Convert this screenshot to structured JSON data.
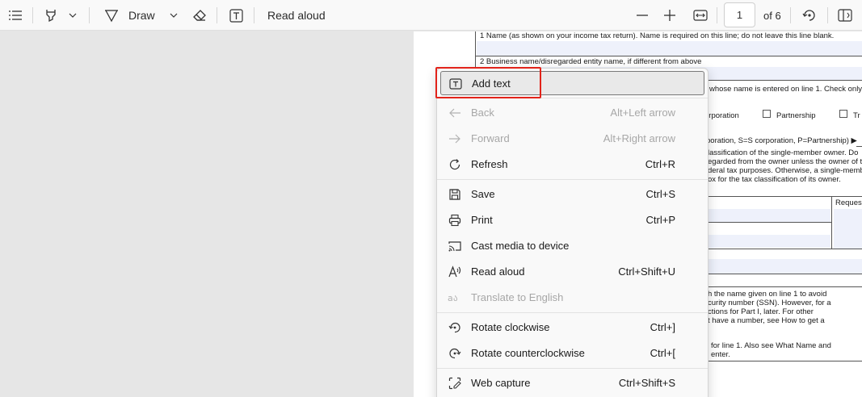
{
  "toolbar": {
    "draw_label": "Draw",
    "read_aloud_label": "Read aloud",
    "page_number": "1",
    "page_total": "of 6"
  },
  "document": {
    "line1_label": "1  Name (as shown on your income tax return). Name is required on this line; do not leave this line blank.",
    "line2_label": "2  Business name/disregarded entity name, if different from above",
    "line3_fragment": "whose name is entered on line 1. Check only o",
    "corporation_fragment": "orporation",
    "partnership_label": "Partnership",
    "trust_fragment": "Tr",
    "llc_fragment": "poration, S=S corporation, P=Partnership) ▶",
    "llc_note_lines": [
      "lassification of the single-member owner.  Do",
      "egarded from the owner unless the owner of t",
      "deral tax purposes. Otherwise, a single-memb",
      "ox for the tax classification of its owner."
    ],
    "requester_fragment": "Reques",
    "part1_lines": [
      "h the name given on line 1 to avoid",
      "curity number (SSN). However, for a",
      "ctions for Part I, later. For other",
      "t have a number, see How to get a"
    ],
    "part1_lines2": [
      "for line 1. Also see What Name and",
      "enter."
    ]
  },
  "context_menu": {
    "items": [
      {
        "label": "Add text",
        "shortcut": "",
        "icon": "add-text-icon",
        "disabled": false
      },
      {
        "label": "Back",
        "shortcut": "Alt+Left arrow",
        "icon": "back-arrow-icon",
        "disabled": true
      },
      {
        "label": "Forward",
        "shortcut": "Alt+Right arrow",
        "icon": "forward-arrow-icon",
        "disabled": true
      },
      {
        "label": "Refresh",
        "shortcut": "Ctrl+R",
        "icon": "refresh-icon",
        "disabled": false
      },
      {
        "label": "Save",
        "shortcut": "Ctrl+S",
        "icon": "save-icon",
        "disabled": false
      },
      {
        "label": "Print",
        "shortcut": "Ctrl+P",
        "icon": "print-icon",
        "disabled": false
      },
      {
        "label": "Cast media to device",
        "shortcut": "",
        "icon": "cast-icon",
        "disabled": false
      },
      {
        "label": "Read aloud",
        "shortcut": "Ctrl+Shift+U",
        "icon": "read-aloud-icon",
        "disabled": false
      },
      {
        "label": "Translate to English",
        "shortcut": "",
        "icon": "translate-icon",
        "disabled": true
      },
      {
        "label": "Rotate clockwise",
        "shortcut": "Ctrl+]",
        "icon": "rotate-clockwise-icon",
        "disabled": false
      },
      {
        "label": "Rotate counterclockwise",
        "shortcut": "Ctrl+[",
        "icon": "rotate-counterclockwise-icon",
        "disabled": false
      },
      {
        "label": "Web capture",
        "shortcut": "Ctrl+Shift+S",
        "icon": "web-capture-icon",
        "disabled": false
      }
    ]
  },
  "colors": {
    "highlight": "#e2231a",
    "toolbar_bg": "#f9f9f9",
    "menu_bg": "#f9f9f9",
    "viewer_bg": "#e6e6e6",
    "field_tint": "#eef1fb"
  }
}
